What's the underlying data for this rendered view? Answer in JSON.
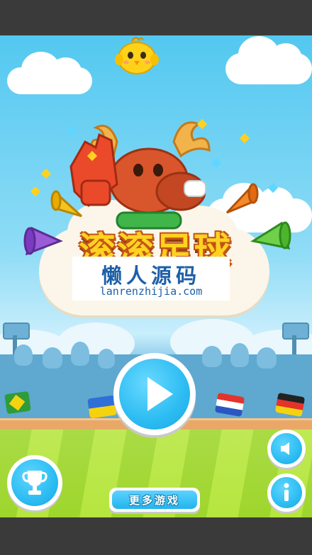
{
  "game": {
    "title": "滚滚足球",
    "watermark_cn": "懒人源码",
    "watermark_en": "lanrenzhijia.com"
  },
  "buttons": {
    "play_icon": "play-icon",
    "trophy_icon": "trophy-icon",
    "sound_icon": "speaker-icon",
    "info_icon": "info-icon",
    "more_games_label": "更多游戏"
  },
  "flags": [
    "brazil",
    "ukraine",
    "netherlands",
    "germany"
  ],
  "colors": {
    "sky": "#53c8f0",
    "button_blue": "#2cbcf2",
    "title_yellow": "#ffd21f",
    "title_outline": "#c2551a",
    "grass_light": "#b6e63e",
    "grass_dark": "#9ed62c",
    "letterbox": "#3a3a3a"
  }
}
